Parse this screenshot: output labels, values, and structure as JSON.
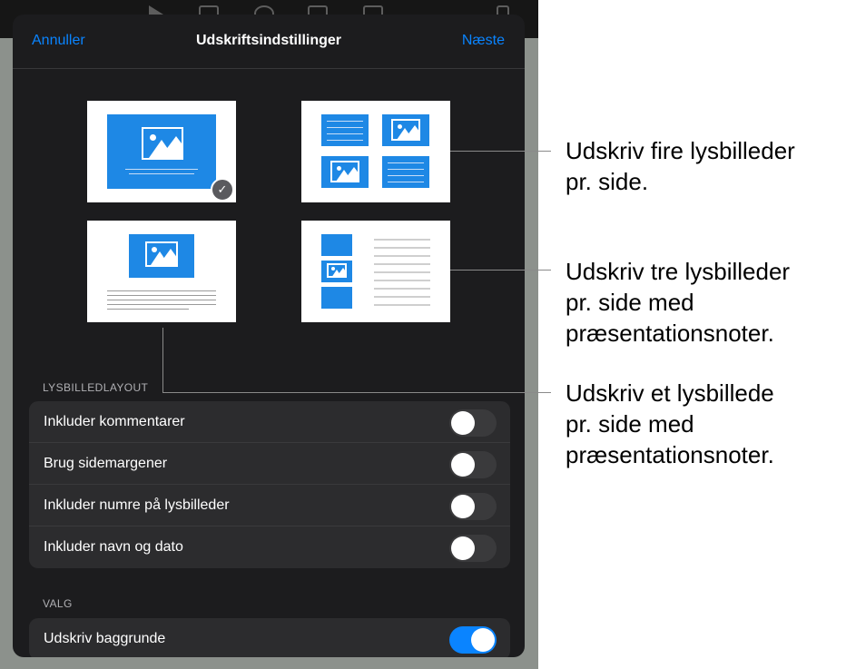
{
  "nav": {
    "cancel_label": "Annuller",
    "title": "Udskriftsindstillinger",
    "next_label": "Næste"
  },
  "layouts": [
    {
      "id": "one-slide",
      "selected": true
    },
    {
      "id": "four-slides",
      "selected": false
    },
    {
      "id": "one-slide-with-notes",
      "selected": false
    },
    {
      "id": "three-slides-with-notes",
      "selected": false
    }
  ],
  "icons": {
    "selected_check": "checkmark-icon",
    "thumbnail_image": "image-placeholder-icon"
  },
  "sections": {
    "slide_layout": {
      "label": "LYSBILLEDLAYOUT",
      "options": [
        {
          "label": "Inkluder kommentarer",
          "on": false
        },
        {
          "label": "Brug sidemargener",
          "on": false
        },
        {
          "label": "Inkluder numre på lysbilleder",
          "on": false
        },
        {
          "label": "Inkluder navn og dato",
          "on": false
        }
      ]
    },
    "options": {
      "label": "VALG",
      "items": [
        {
          "label": "Udskriv baggrunde",
          "on": true
        }
      ]
    }
  },
  "callouts": {
    "four": {
      "line1": "Udskriv fire lysbilleder",
      "line2": "pr. side."
    },
    "three_notes": {
      "line1": "Udskriv tre lysbilleder",
      "line2": "pr. side med",
      "line3": "præsentationsnoter."
    },
    "one_notes": {
      "line1": "Udskriv et lysbillede",
      "line2": "pr. side med",
      "line3": "præsentationsnoter."
    }
  },
  "colors": {
    "accent": "#0a84ff",
    "sheet_bg": "#1c1c1e",
    "row_bg": "#2c2c2e",
    "thumb_blue": "#1e88e5"
  }
}
